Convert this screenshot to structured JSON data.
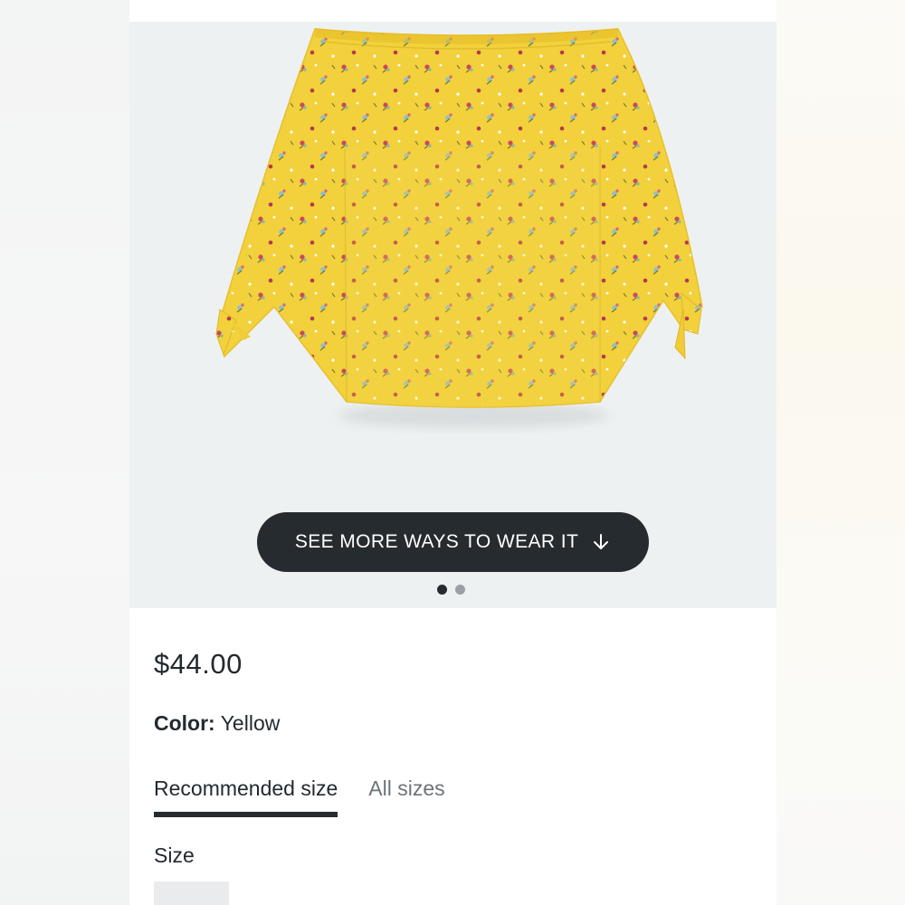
{
  "product": {
    "cta_label": "SEE MORE WAYS TO WEAR IT",
    "cta_icon": "arrow-down-icon",
    "carousel_count": 2,
    "carousel_active": 1,
    "price": "$44.00",
    "color_label": "Color:",
    "color_value": "Yellow",
    "tabs": [
      {
        "label": "Recommended size",
        "active": true
      },
      {
        "label": "All sizes",
        "active": false
      }
    ],
    "size_label": "Size"
  },
  "colors": {
    "fabric": "#f2d13c",
    "button": "#262b30",
    "background": "#eef1f2"
  }
}
